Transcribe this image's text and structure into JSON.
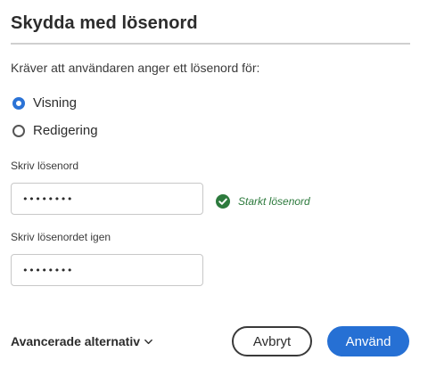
{
  "dialog": {
    "title": "Skydda med lösenord",
    "description": "Kräver att användaren anger ett lösenord för:",
    "options": [
      {
        "label": "Visning",
        "selected": true
      },
      {
        "label": "Redigering",
        "selected": false
      }
    ],
    "password": {
      "label": "Skriv lösenord",
      "value": "••••••••",
      "strength": "Starkt lösenord"
    },
    "confirm": {
      "label": "Skriv lösenordet igen",
      "value": "••••••••"
    },
    "advanced_label": "Avancerade alternativ",
    "cancel_label": "Avbryt",
    "apply_label": "Använd"
  },
  "colors": {
    "accent": "#2670d4",
    "success": "#2d7a3d"
  },
  "icons": {
    "strength": "check-circle-icon",
    "advanced": "chevron-down-icon"
  }
}
